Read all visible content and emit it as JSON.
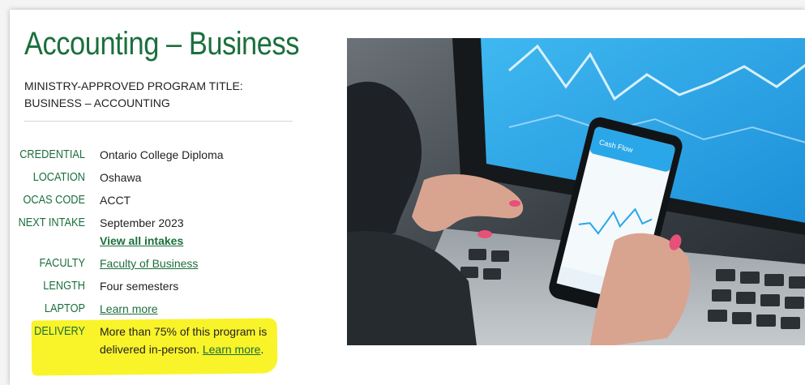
{
  "program": {
    "title": "Accounting – Business",
    "ministry_title": "MINISTRY-APPROVED PROGRAM TITLE: BUSINESS – ACCOUNTING"
  },
  "details": {
    "credential": {
      "label": "CREDENTIAL",
      "value": "Ontario College Diploma"
    },
    "location": {
      "label": "LOCATION",
      "value": "Oshawa"
    },
    "ocas_code": {
      "label": "OCAS CODE",
      "value": "ACCT"
    },
    "next_intake": {
      "label": "NEXT INTAKE",
      "value": "September 2023",
      "link": "View all intakes"
    },
    "faculty": {
      "label": "FACULTY",
      "value": "Faculty of Business"
    },
    "length": {
      "label": "LENGTH",
      "value": "Four semesters"
    },
    "laptop": {
      "label": "LAPTOP",
      "link": "Learn more"
    },
    "delivery": {
      "label": "DELIVERY",
      "line1": "More than 75% of this program is",
      "line2": "delivered in-person. ",
      "link": "Learn more",
      "period": "."
    }
  },
  "image": {
    "phone_app_title": "Cash Flow",
    "icon": "phone-laptop-finance-photo"
  },
  "colors": {
    "brand_green": "#1b6f3c",
    "highlight_yellow": "#f9f32a",
    "screen_blue": "#2aa7e8"
  }
}
